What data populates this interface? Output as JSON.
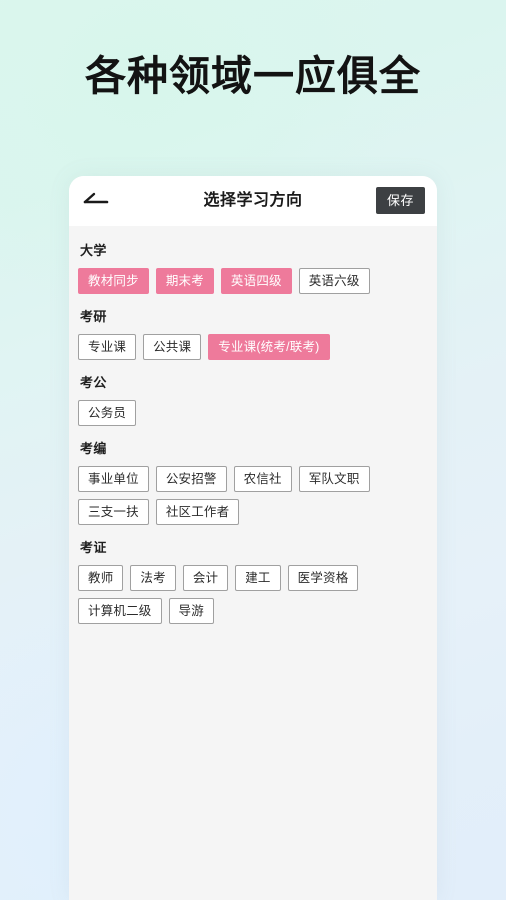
{
  "promo": {
    "headline": "各种领域一应俱全",
    "background_colors": {
      "mint": "#dcf6ee",
      "blue": "#e2eefa"
    }
  },
  "app": {
    "header": {
      "back_icon": "arrow-left-icon",
      "title": "选择学习方向",
      "save_label": "保存"
    },
    "accent_color": "#ee7a9b",
    "save_button_color": "#3d4043",
    "groups": [
      {
        "title": "大学",
        "chips": [
          {
            "label": "教材同步",
            "selected": true
          },
          {
            "label": "期末考",
            "selected": true
          },
          {
            "label": "英语四级",
            "selected": true
          },
          {
            "label": "英语六级",
            "selected": false
          }
        ]
      },
      {
        "title": "考研",
        "chips": [
          {
            "label": "专业课",
            "selected": false
          },
          {
            "label": "公共课",
            "selected": false
          },
          {
            "label": "专业课(统考/联考)",
            "selected": true
          }
        ]
      },
      {
        "title": "考公",
        "chips": [
          {
            "label": "公务员",
            "selected": false
          }
        ]
      },
      {
        "title": "考编",
        "chips": [
          {
            "label": "事业单位",
            "selected": false
          },
          {
            "label": "公安招警",
            "selected": false
          },
          {
            "label": "农信社",
            "selected": false
          },
          {
            "label": "军队文职",
            "selected": false
          },
          {
            "label": "三支一扶",
            "selected": false
          },
          {
            "label": "社区工作者",
            "selected": false
          }
        ]
      },
      {
        "title": "考证",
        "chips": [
          {
            "label": "教师",
            "selected": false
          },
          {
            "label": "法考",
            "selected": false
          },
          {
            "label": "会计",
            "selected": false
          },
          {
            "label": "建工",
            "selected": false
          },
          {
            "label": "医学资格",
            "selected": false
          },
          {
            "label": "计算机二级",
            "selected": false
          },
          {
            "label": "导游",
            "selected": false
          }
        ]
      }
    ]
  }
}
